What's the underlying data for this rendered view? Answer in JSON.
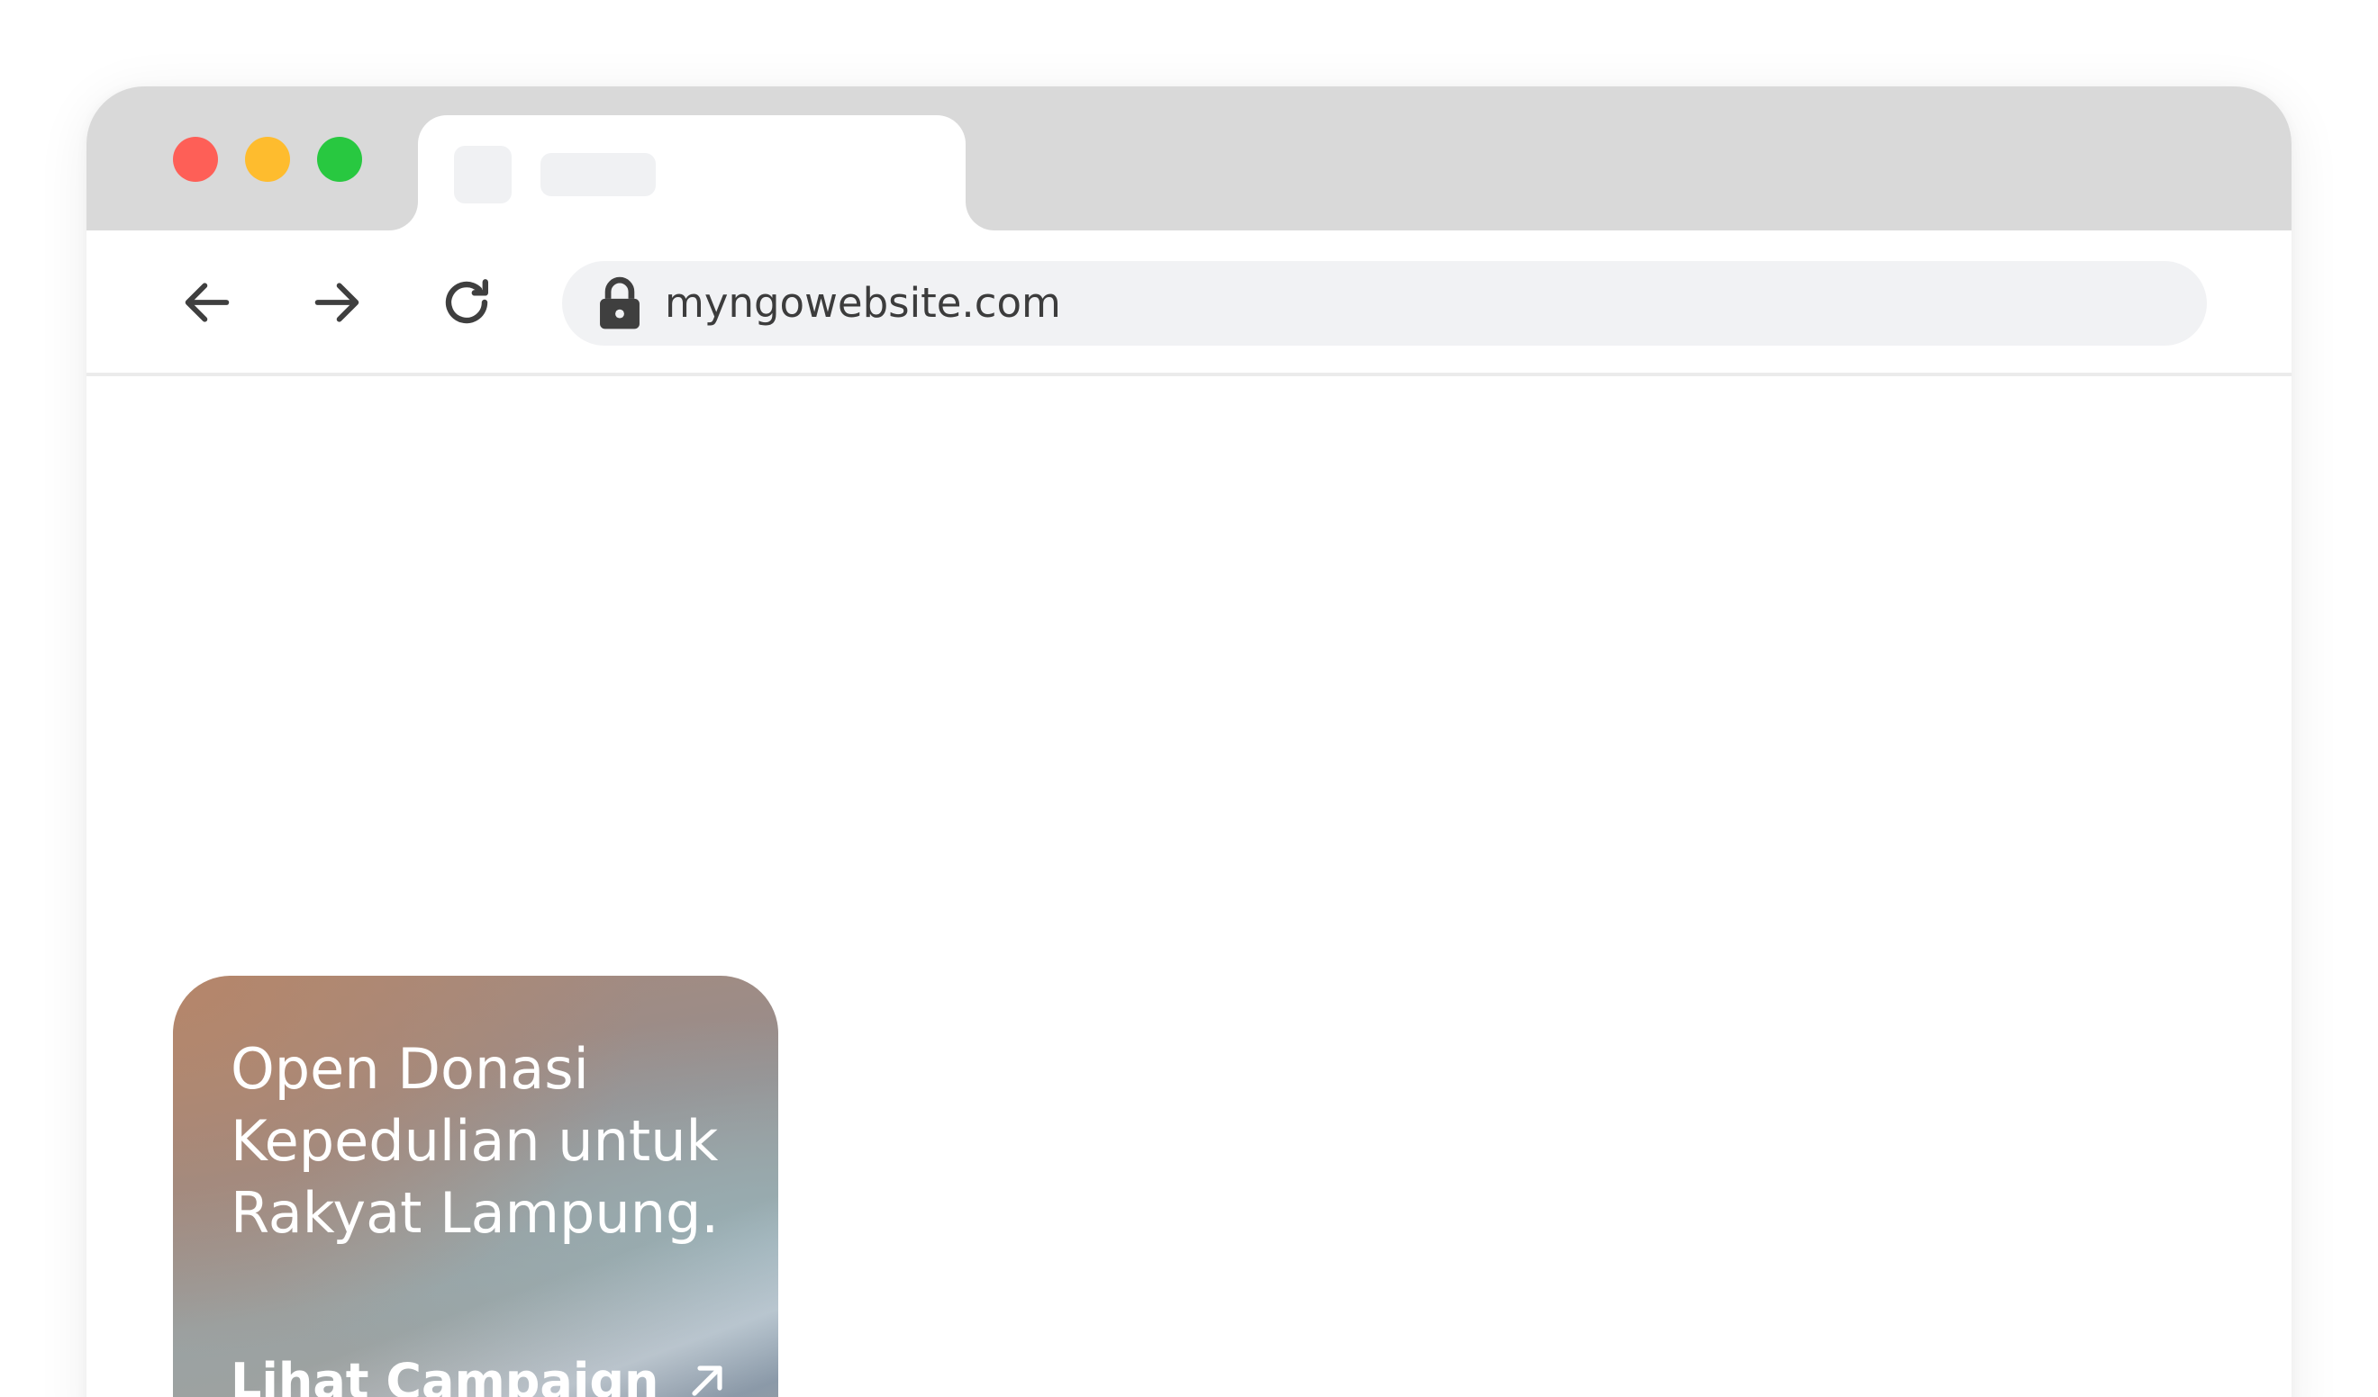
{
  "browser": {
    "tab": {
      "favicon_icon": "blank-favicon-placeholder",
      "title_placeholder": true
    },
    "toolbar": {
      "back_icon": "arrow-left-icon",
      "forward_icon": "arrow-right-icon",
      "reload_icon": "reload-icon",
      "address": {
        "lock_icon": "lock-icon",
        "url": "myngowebsite.com"
      }
    },
    "traffic_lights": {
      "close_color": "#fe5f57",
      "minimize_color": "#febc2e",
      "maximize_color": "#28c840"
    }
  },
  "campaign_card": {
    "title_lines": [
      "Open Donasi",
      "Kepedulian untuk",
      "Rakyat Lampung."
    ],
    "link_label": "Lihat Campaign",
    "link_icon": "arrow-up-right-icon"
  }
}
